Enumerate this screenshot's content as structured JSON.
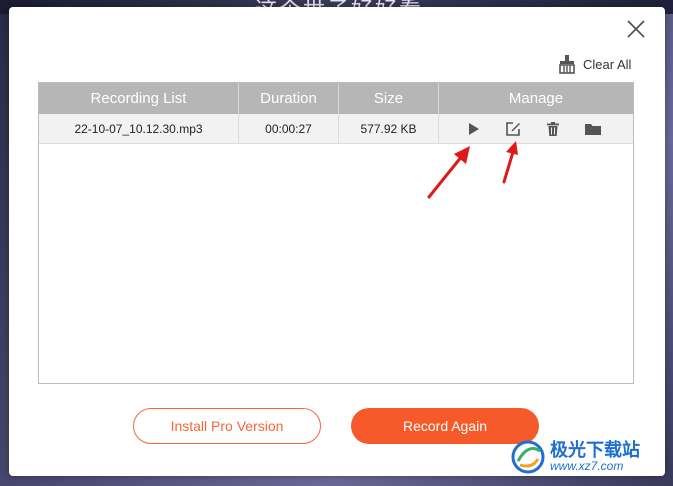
{
  "background": {
    "text": "这个世子好好看"
  },
  "dialog": {
    "toolbar": {
      "clear_all_label": "Clear All"
    },
    "table": {
      "columns": [
        "Recording List",
        "Duration",
        "Size",
        "Manage"
      ],
      "rows": [
        {
          "name": "22-10-07_10.12.30.mp3",
          "duration": "00:00:27",
          "size": "577.92 KB"
        }
      ]
    },
    "buttons": {
      "install_label": "Install Pro Version",
      "record_label": "Record Again"
    }
  },
  "watermark": {
    "brand": "极光下载站",
    "url": "www.xz7.com"
  },
  "colors": {
    "accent": "#f65a2a",
    "header_gray": "#b6b6b6",
    "watermark_blue": "#1f6fd0"
  },
  "icons": [
    "close-icon",
    "broom-icon",
    "play-icon",
    "edit-icon",
    "trash-icon",
    "folder-icon"
  ]
}
